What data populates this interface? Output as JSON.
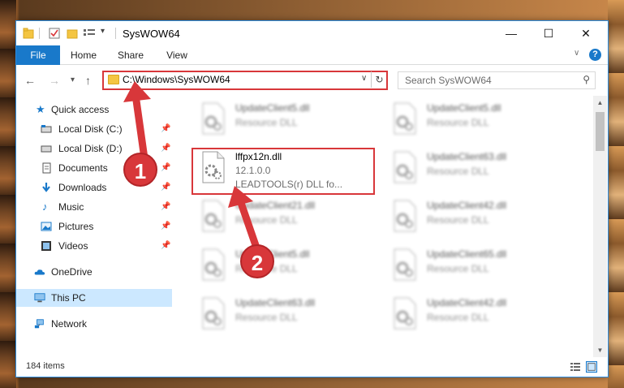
{
  "window": {
    "title": "SysWOW64"
  },
  "ribbon": {
    "file_tab": "File",
    "tabs": [
      "Home",
      "Share",
      "View"
    ],
    "help": "?"
  },
  "navigation": {
    "back": "←",
    "forward": "→",
    "recent": "▾",
    "up": "↑",
    "address": "C:\\Windows\\SysWOW64",
    "search_placeholder": "Search SysWOW64"
  },
  "sidebar": {
    "items": [
      {
        "label": "Quick access",
        "icon": "star-icon",
        "pinned": false
      },
      {
        "label": "Local Disk (C:)",
        "icon": "drive-icon",
        "pinned": true
      },
      {
        "label": "Local Disk (D:)",
        "icon": "drive-icon",
        "pinned": true
      },
      {
        "label": "Documents",
        "icon": "documents-icon",
        "pinned": true
      },
      {
        "label": "Downloads",
        "icon": "download-icon",
        "pinned": true
      },
      {
        "label": "Music",
        "icon": "music-icon",
        "pinned": true
      },
      {
        "label": "Pictures",
        "icon": "pictures-icon",
        "pinned": true
      },
      {
        "label": "Videos",
        "icon": "videos-icon",
        "pinned": true
      },
      {
        "label": "OneDrive",
        "icon": "cloud-icon",
        "pinned": false
      },
      {
        "label": "This PC",
        "icon": "computer-icon",
        "pinned": false,
        "selected": true
      },
      {
        "label": "Network",
        "icon": "network-icon",
        "pinned": false
      }
    ]
  },
  "files": {
    "left": [
      {
        "name": "UpdateClient5.dll",
        "desc": "Resource DLL"
      },
      {
        "name": "lffpx12n.dll",
        "version": "12.1.0.0",
        "desc": "LEADTOOLS(r) DLL fo..."
      },
      {
        "name": "UpdateClient21.dll",
        "desc": "Resource DLL"
      },
      {
        "name": "UpdateClient5.dll",
        "desc": "Resource DLL"
      },
      {
        "name": "UpdateClient63.dll",
        "desc": "Resource DLL"
      }
    ],
    "right": [
      {
        "name": "UpdateClient5.dll",
        "desc": "Resource DLL"
      },
      {
        "name": "UpdateClient63.dll",
        "desc": "Resource DLL"
      },
      {
        "name": "UpdateClient42.dll",
        "desc": "Resource DLL"
      },
      {
        "name": "UpdateClient65.dll",
        "desc": "Resource DLL"
      },
      {
        "name": "UpdateClient42.dll",
        "desc": "Resource DLL"
      }
    ]
  },
  "status": {
    "count": "184 items"
  },
  "annotations": {
    "step1": "1",
    "step2": "2",
    "color": "#d8373a"
  }
}
